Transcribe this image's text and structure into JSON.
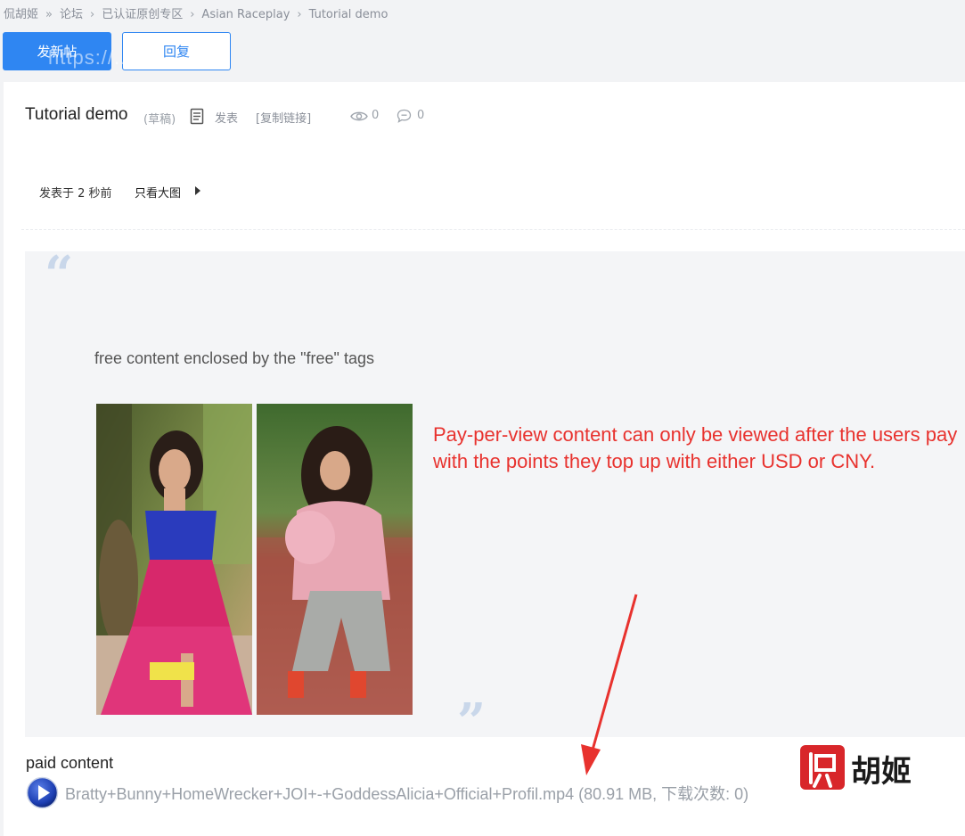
{
  "breadcrumb": {
    "site": "侃胡姬",
    "sep_first": "»",
    "forum": "论坛",
    "sep": "›",
    "section": "已认证原创专区",
    "board": "Asian Raceplay",
    "current": "Tutorial demo"
  },
  "actions": {
    "new_post": "发新帖",
    "reply": "回复"
  },
  "watermark_url": "https://...",
  "post": {
    "title": "Tutorial demo",
    "draft_tag": "(草稿)",
    "publish_label": "发表",
    "copy_link_label": "[复制链接]",
    "views": "0",
    "replies": "0",
    "posted_time": "发表于 2 秒前",
    "only_big_image": "只看大图"
  },
  "content": {
    "free_text": "free content enclosed by the \"free\" tags",
    "annotation": "Pay-per-view content can only be viewed after the users pay with the points they top up with either USD or CNY.",
    "paid_label": "paid content",
    "attachment_name": "Bratty+Bunny+HomeWrecker+JOI+-+GoddessAlicia+Official+Profil.mp4",
    "attachment_meta": "(80.91 MB, 下载次数: 0)"
  },
  "logo": {
    "seal_char": "侃",
    "text": "胡姬"
  },
  "colors": {
    "primary": "#2f86f2",
    "annotation_red": "#e8322e",
    "quote_bg": "#f4f5f7"
  },
  "icons": [
    "document-icon",
    "eye-icon",
    "comment-icon",
    "play-icon",
    "arrow-right-icon",
    "quote-open-icon",
    "quote-close-icon"
  ]
}
